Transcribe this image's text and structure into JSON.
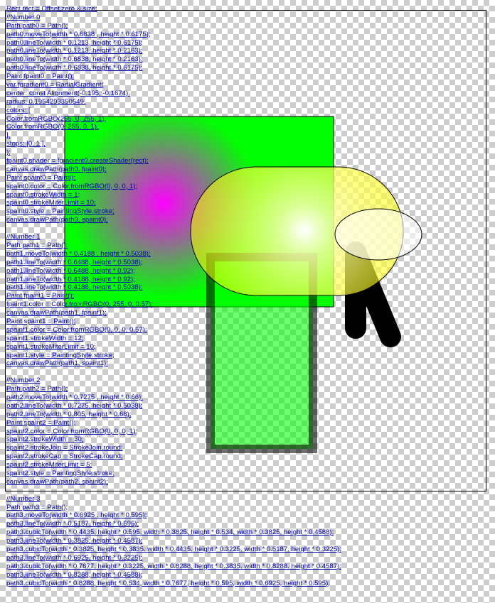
{
  "code_lines": [
    "Rect rect = Offset.zero & size;",
    "//Number 0",
    "Path path0 = Path();",
    "path0.moveTo(width * 0.6838 , height * 0.6175);",
    "path0.lineTo(width * 0.1213, height * 0.6175);",
    "path0.lineTo(width * 0.1213, height * 0.2163);",
    "path0.lineTo(width * 0.6838, height * 0.2163);",
    "path0.lineTo(width * 0.6838, height * 0.6175);",
    "Paint fpaint0 = Paint();",
    "var fgradient0 = RadialGradient(",
    "center: const Alignment(-0.195, -0.1674),",
    "radius: 0.1954293350549,",
    "colors: [",
    "Color.fromRGBO(255, 0, 255, 1),",
    "Color.fromRGBO(0, 255, 0, 1),",
    "],",
    "stops: [0, 1 ],",
    ");",
    "fpaint0.shader = fgradient0.createShader(rect);",
    "canvas.drawPath(path0, fpaint0);",
    "Paint spaint0 = Paint();",
    "spaint0.color = Color.fromRGBO(0, 0, 0, 1);",
    "spaint0.strokeWidth = 1;",
    "spaint0.strokeMiterLimit = 10;",
    "spaint0.style = PaintingStyle.stroke;",
    "canvas.drawPath(path0, spaint0);",
    "",
    "//Number 1",
    "Path path1 = Path();",
    "path1.moveTo(width * 0.4188 , height * 0.5038);",
    "path1.lineTo(width * 0.6488, height * 0.5038);",
    "path1.lineTo(width * 0.6488, height * 0.92);",
    "path1.lineTo(width * 0.4188, height * 0.92);",
    "path1.lineTo(width * 0.4188, height * 0.5038);",
    "Paint fpaint1 = Paint();",
    "fpaint1.color = Color.fromRGBO(0, 255, 0, 0.57);",
    "canvas.drawPath(path1, fpaint1);",
    "Paint spaint1 = Paint();",
    "spaint1.color = Color.fromRGBO(0, 0, 0, 0.57);",
    "spaint1.strokeWidth = 12;",
    "spaint1.strokeMiterLimit = 10;",
    "spaint1.style = PaintingStyle.stroke;",
    "canvas.drawPath(path1, spaint1);",
    "",
    "//Number 2",
    "Path path2 = Path();",
    "path2.moveTo(width * 0.7275 , height * 0.66);",
    "path2.lineTo(width * 0.7275, height * 0.5038);",
    "path2.lineTo(width * 0.805, height * 0.68);",
    "Paint spaint2 = Paint();",
    "spaint2.color = Color.fromRGBO(0, 0, 0, 1);",
    "spaint2.strokeWidth = 30;",
    "spaint2.strokeJoin = StrokeJoin.round;",
    "spaint2.strokeCap = StrokeCap.round;",
    "spaint2.strokeMiterLimit = 5;",
    "spaint2.style = PaintingStyle.stroke;",
    "canvas.drawPath(path2, spaint2);",
    "",
    "//Number 3",
    "Path path3 = Path();",
    "path3.moveTo(width * 0.6925 , height * 0.595);",
    "path3.lineTo(width * 0.5187, height * 0.595);",
    "path3.cubicTo(width * 0.4435, height * 0.595, width * 0.3825, height * 0.534, width * 0.3825, height * 0.4588);",
    "path3.lineTo(width * 0.3825, height * 0.4587);",
    "path3.cubicTo(width * 0.3825, height * 0.3835, width * 0.4435, height * 0.3225, width * 0.5187, height * 0.3225);",
    "path3.lineTo(width * 0.6925, height * 0.3225);",
    "path3.cubicTo(width * 0.7677, height * 0.3225, width * 0.8288, height * 0.3835, width * 0.8288, height * 0.4587);",
    "path3.lineTo(width * 0.8288, height * 0.4588);",
    "path3.cubicTo(width * 0.8288, height * 0.534, width * 0.7677, height * 0.595, width * 0.6925, height * 0.595);"
  ],
  "colors": {
    "background": "#ffffff",
    "checker": "#cccccc",
    "code_text": "#0000aa",
    "gradient_center": "#ff00ff",
    "gradient_edge": "#00ff00",
    "green_rect_fill": "#00ff00",
    "green_rect_stroke": "#000000",
    "stroke_black": "#000000",
    "pill_fill": "#ffff00",
    "white": "#ffffff"
  }
}
